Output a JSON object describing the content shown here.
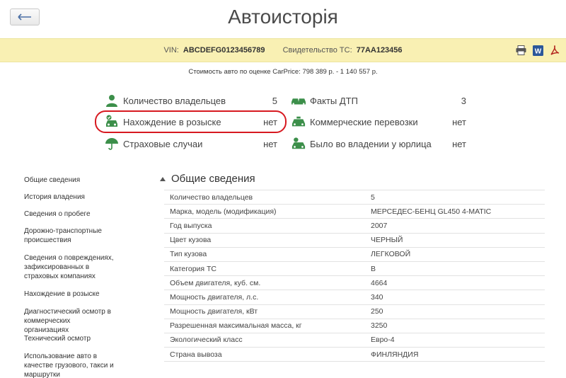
{
  "header": {
    "title": "Автоисторія"
  },
  "vin_bar": {
    "vin_label": "VIN:",
    "vin_value": "ABCDEFG0123456789",
    "cert_label": "Свидетельство ТС:",
    "cert_value": "77AA123456",
    "icons": [
      "print-icon",
      "word-icon",
      "pdf-icon"
    ]
  },
  "price_text": "Стоимость авто по оценке CarPrice: 798 389 р. - 1 140 557 р.",
  "summary": {
    "left": [
      {
        "label": "Количество владельцев",
        "value": "5",
        "icon": "person-icon"
      },
      {
        "label": "Нахождение в розыске",
        "value": "нет",
        "icon": "car-check-icon"
      },
      {
        "label": "Страховые случаи",
        "value": "нет",
        "icon": "umbrella-icon"
      }
    ],
    "right": [
      {
        "label": "Факты ДТП",
        "value": "3",
        "icon": "crash-icon"
      },
      {
        "label": "Коммерческие перевозки",
        "value": "нет",
        "icon": "taxi-icon"
      },
      {
        "label": "Было во владении у юрлица",
        "value": "нет",
        "icon": "company-car-icon"
      }
    ]
  },
  "sidebar": [
    "Общие сведения",
    "История владения",
    "Сведения о пробеге",
    "Дорожно-транспортные происшествия",
    "Сведения о повреждениях, зафиксированных в страховых компаниях",
    "Нахождение в розыске",
    "Диагностический осмотр в коммерческих организациях",
    "Технический осмотр",
    "Использование авто в качестве грузового, такси и маршрутки"
  ],
  "section": {
    "title": "Общие сведения",
    "rows": [
      [
        "Количество владельцев",
        "5"
      ],
      [
        "Марка, модель (модификация)",
        "МЕРСЕДЕС-БЕНЦ GL450 4-MATIC"
      ],
      [
        "Год выпуска",
        "2007"
      ],
      [
        "Цвет кузова",
        "ЧЕРНЫЙ"
      ],
      [
        "Тип кузова",
        "ЛЕГКОВОЙ"
      ],
      [
        "Категория ТС",
        "B"
      ],
      [
        "Объем двигателя, куб. см.",
        "4664"
      ],
      [
        "Мощность двигателя, л.с.",
        "340"
      ],
      [
        "Мощность двигателя, кВт",
        "250"
      ],
      [
        "Разрешенная максимальная масса, кг",
        "3250"
      ],
      [
        "Экологический класс",
        "Евро-4"
      ],
      [
        "Страна вывоза",
        "ФИНЛЯНДИЯ"
      ]
    ]
  },
  "colors": {
    "accent_green": "#3c8f4a",
    "bar_yellow": "#f9f0b3",
    "highlight_red": "#d71920"
  }
}
